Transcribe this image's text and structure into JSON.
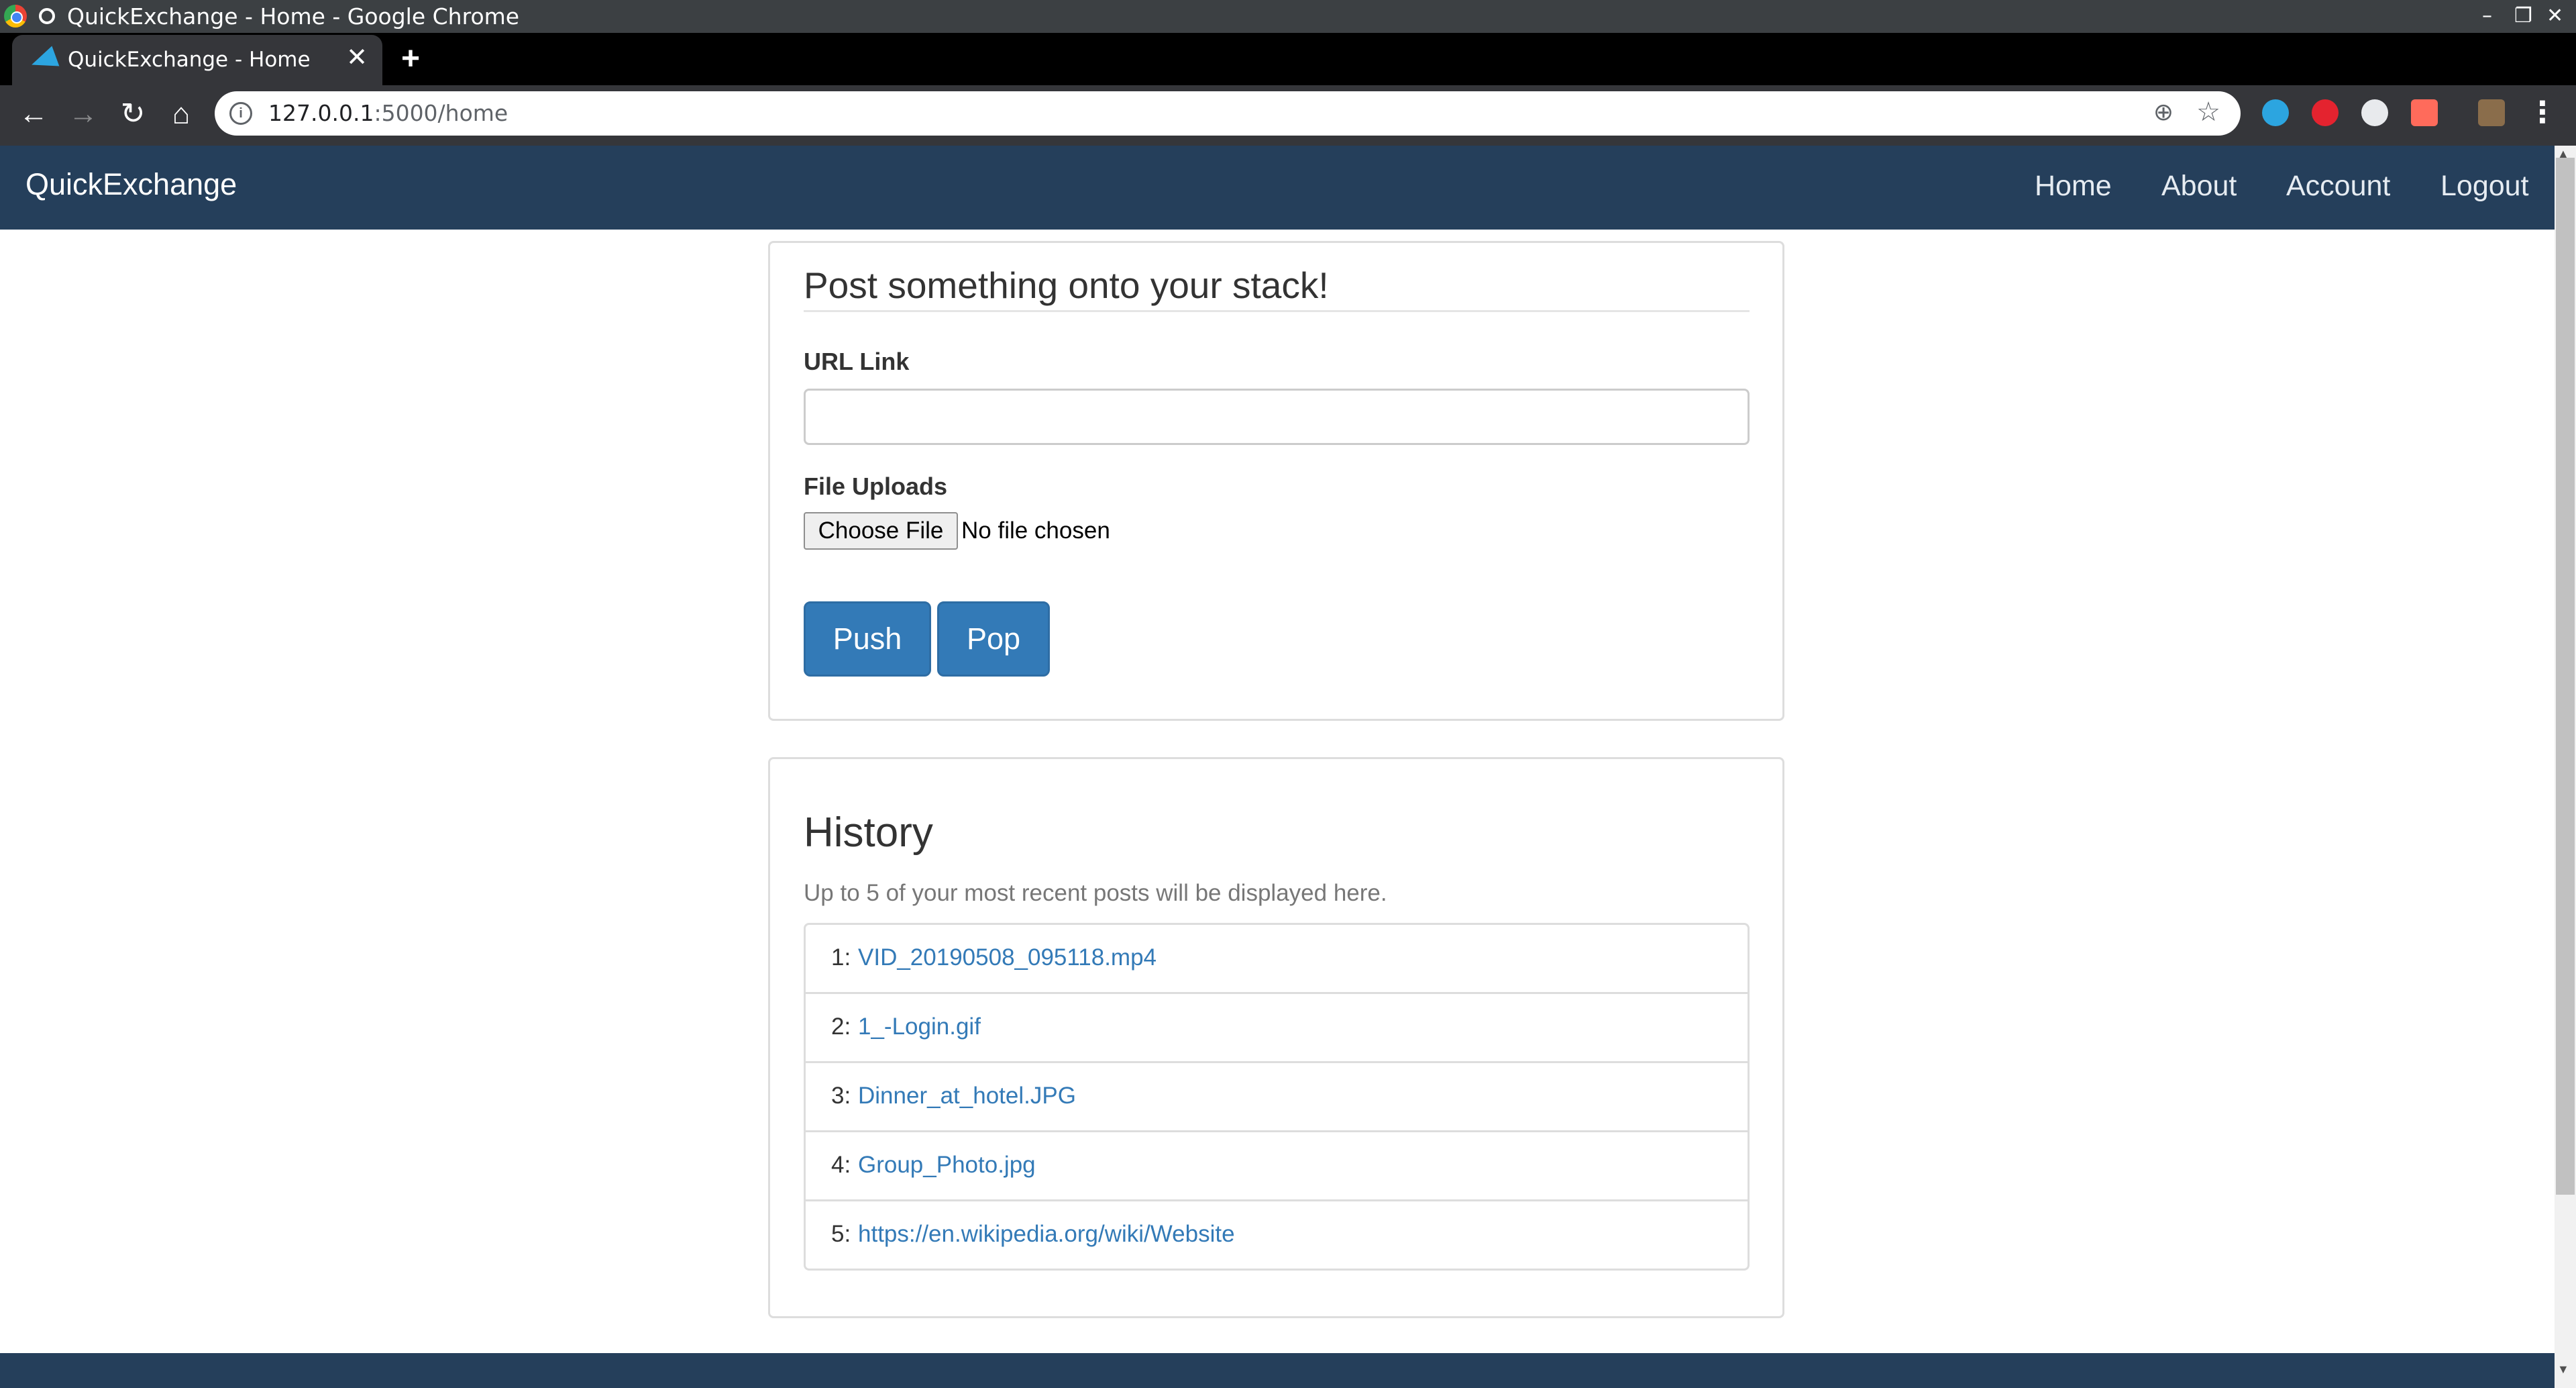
{
  "window": {
    "title": "QuickExchange - Home - Google Chrome",
    "controls": {
      "minimize": "–",
      "maximize": "❐",
      "close": "✕"
    }
  },
  "tab": {
    "label": "QuickExchange - Home",
    "close": "✕",
    "new_tab": "+"
  },
  "toolbar": {
    "back": "←",
    "forward": "→",
    "reload": "↻",
    "home": "⌂",
    "url_host": "127.0.0.1",
    "url_path": ":5000/home",
    "info_glyph": "i",
    "zoom_glyph": "⊕",
    "star_glyph": "☆",
    "menu": "⋮",
    "extensions": [
      {
        "name": "telegram-extension-icon",
        "color": "#2ca5e0"
      },
      {
        "name": "adblock-extension-icon",
        "color": "#e4232f"
      },
      {
        "name": "google-extension-icon",
        "color": "#e8eaed"
      },
      {
        "name": "redirect-extension-icon",
        "color": "#ff6b5b"
      },
      {
        "name": "profile-avatar",
        "color": "#8a6d4b"
      }
    ]
  },
  "navbar": {
    "brand": "QuickExchange",
    "links": [
      "Home",
      "About",
      "Account",
      "Logout"
    ],
    "background": "#253f5b"
  },
  "post_form": {
    "legend": "Post something onto your stack!",
    "url_label": "URL Link",
    "url_value": "",
    "file_label": "File Uploads",
    "file_button": "Choose File",
    "file_status": "No file chosen",
    "push_label": "Push",
    "pop_label": "Pop",
    "button_color": "#337ab7"
  },
  "history": {
    "title": "History",
    "description": "Up to 5 of your most recent posts will be displayed here.",
    "items": [
      {
        "num": "1:",
        "text": "VID_20190508_095118.mp4"
      },
      {
        "num": "2:",
        "text": "1_-Login.gif"
      },
      {
        "num": "3:",
        "text": "Dinner_at_hotel.JPG"
      },
      {
        "num": "4:",
        "text": "Group_Photo.jpg"
      },
      {
        "num": "5:",
        "text": "https://en.wikipedia.org/wiki/Website"
      }
    ],
    "link_color": "#337ab7"
  }
}
